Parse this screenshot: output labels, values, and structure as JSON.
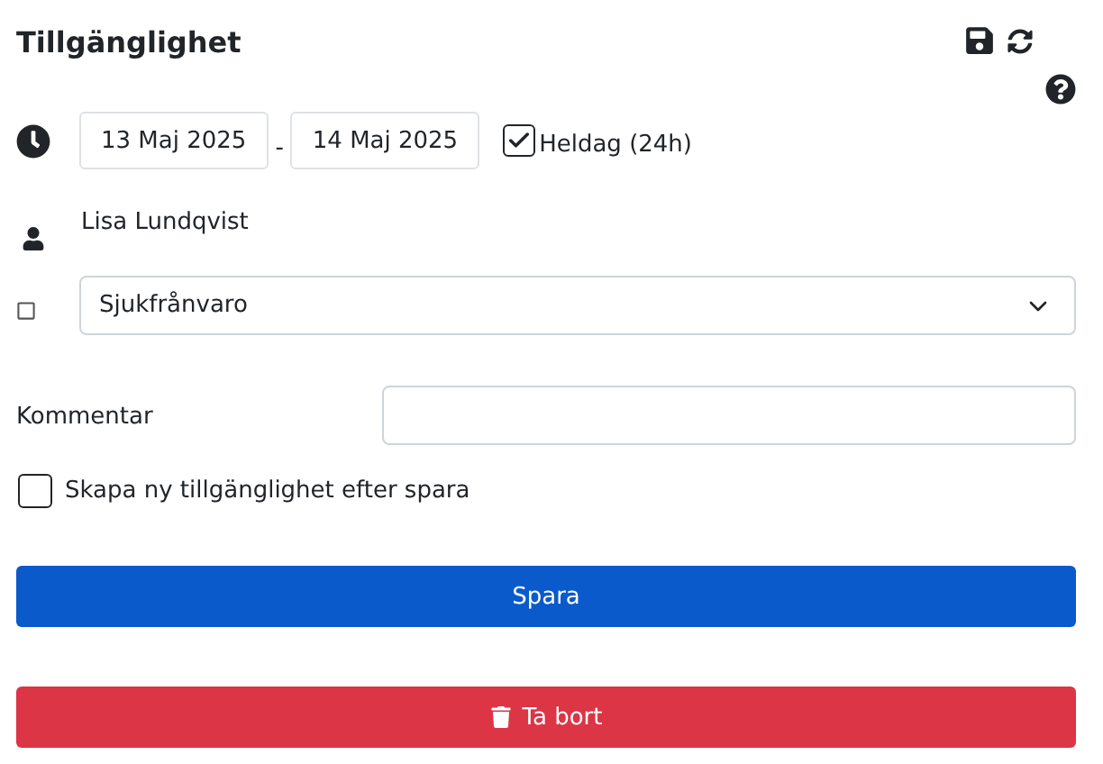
{
  "title": "Tillgänglighet",
  "date_from": "13 Maj 2025",
  "separator": "-",
  "date_to": "14 Maj 2025",
  "all_day": {
    "label": "Heldag (24h)",
    "checked": true
  },
  "person": "Lisa Lundqvist",
  "type_select": {
    "value": "Sjukfrånvaro"
  },
  "comment": {
    "label": "Kommentar"
  },
  "create_new": {
    "label": "Skapa ny tillgänglighet efter spara",
    "checked": false
  },
  "buttons": [
    {
      "kind": "primary",
      "label": "Spara"
    },
    {
      "kind": "danger",
      "label": "Ta bort"
    }
  ]
}
